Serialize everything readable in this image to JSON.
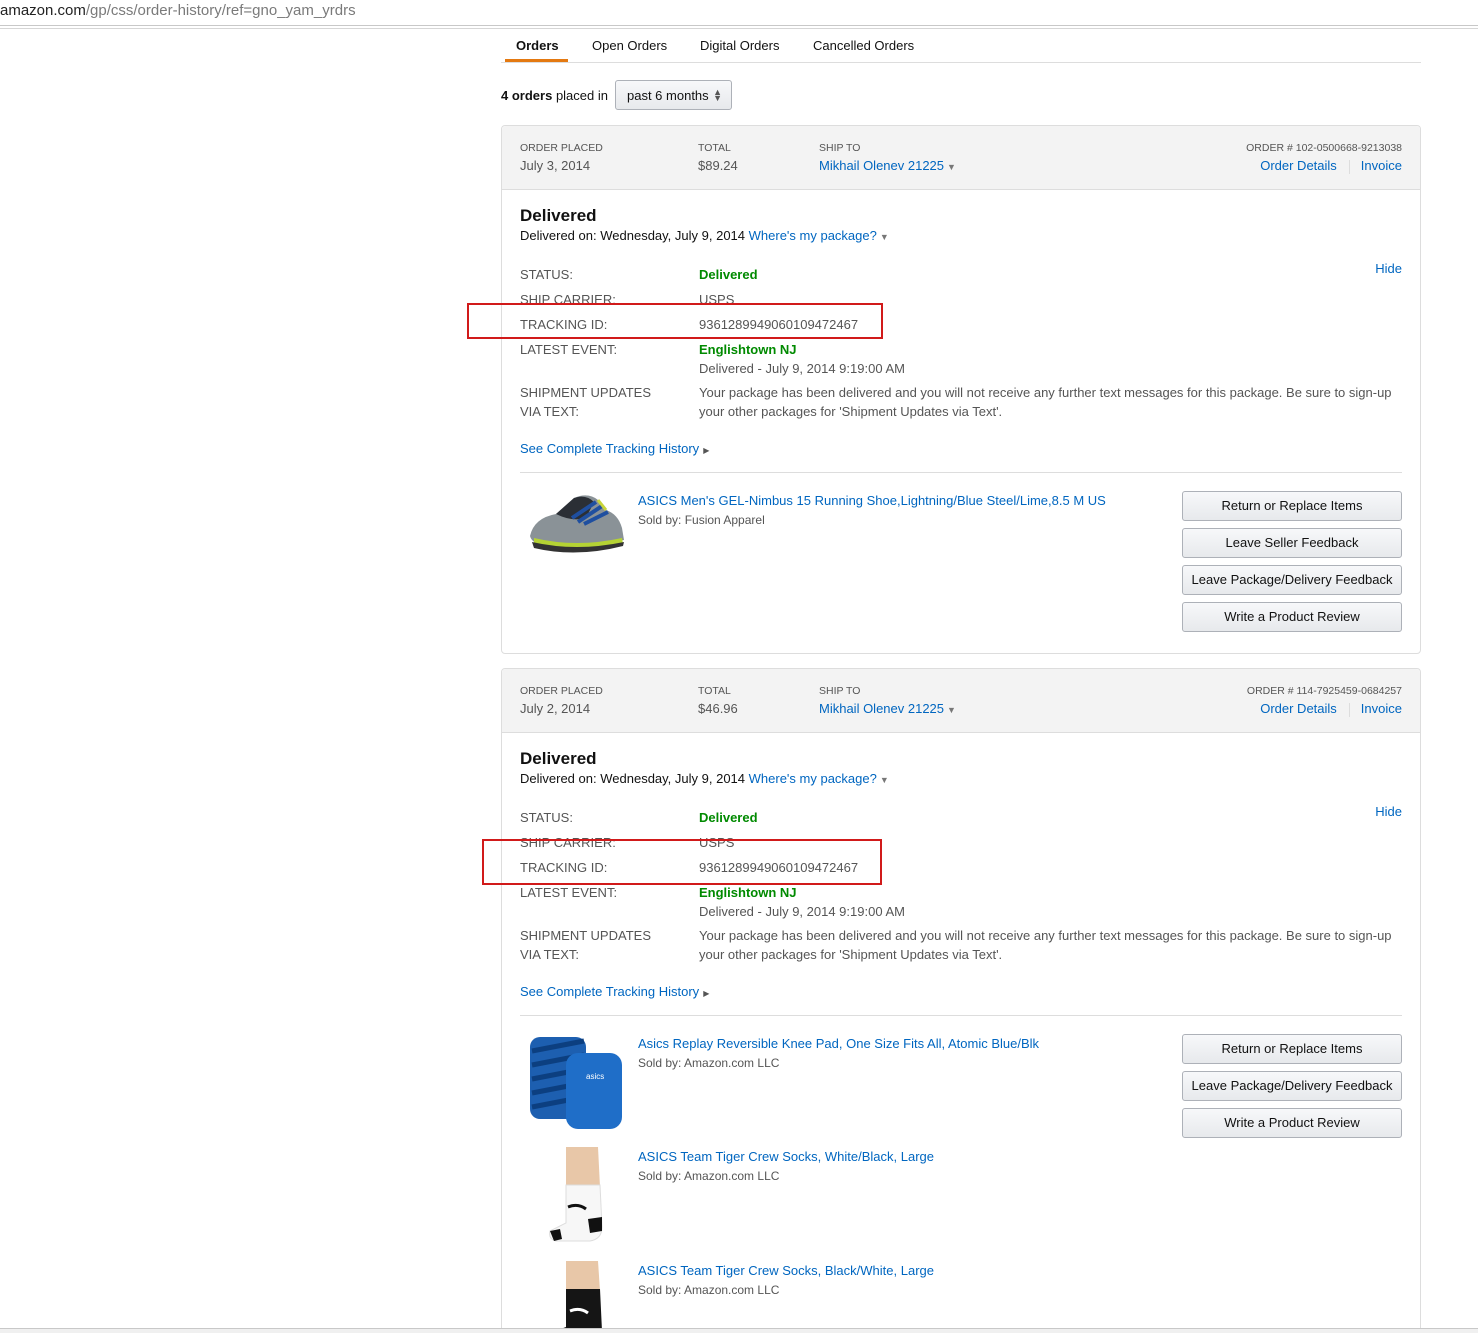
{
  "browser": {
    "url_host": "amazon.com",
    "url_path": "/gp/css/order-history/ref=gno_yam_yrdrs"
  },
  "tabs": [
    {
      "label": "Orders",
      "active": true
    },
    {
      "label": "Open Orders"
    },
    {
      "label": "Digital Orders"
    },
    {
      "label": "Cancelled Orders"
    }
  ],
  "summary": {
    "count_text": "4 orders",
    "placed_in": "placed in",
    "filter_value": "past 6 months"
  },
  "header_labels": {
    "order_placed": "ORDER PLACED",
    "total": "TOTAL",
    "ship_to": "SHIP TO",
    "order_details": "Order Details",
    "invoice": "Invoice"
  },
  "tracking_labels": {
    "status": "STATUS:",
    "carrier": "SHIP CARRIER:",
    "tracking_id": "TRACKING ID:",
    "latest_event": "LATEST EVENT:",
    "updates_line1": "SHIPMENT UPDATES",
    "updates_line2": "VIA TEXT:",
    "hide": "Hide",
    "history": "See Complete Tracking History",
    "delivered_on_prefix": "Delivered on:",
    "where_package": "Where's my package?"
  },
  "orders": [
    {
      "date": "July 3, 2014",
      "total": "$89.24",
      "ship_to": "Mikhail Olenev 21225",
      "order_number": "ORDER # 102-0500668-9213038",
      "status_title": "Delivered",
      "delivered_on": "Wednesday, July 9, 2014",
      "status": "Delivered",
      "carrier": "USPS",
      "tracking_id": "9361289949060109472467",
      "event_location": "Englishtown NJ",
      "event_detail": "Delivered - July 9, 2014 9:19:00 AM",
      "updates_text": "Your package has been delivered and you will not receive any further text messages for this package. Be sure to sign-up your other packages for 'Shipment Updates via Text'.",
      "items": [
        {
          "title": "ASICS Men's GEL-Nimbus 15 Running Shoe,Lightning/Blue Steel/Lime,8.5 M US",
          "seller": "Sold by: Fusion Apparel"
        }
      ],
      "buttons": [
        "Return or Replace Items",
        "Leave Seller Feedback",
        "Leave Package/Delivery Feedback",
        "Write a Product Review"
      ]
    },
    {
      "date": "July 2, 2014",
      "total": "$46.96",
      "ship_to": "Mikhail Olenev 21225",
      "order_number": "ORDER # 114-7925459-0684257",
      "status_title": "Delivered",
      "delivered_on": "Wednesday, July 9, 2014",
      "status": "Delivered",
      "carrier": "USPS",
      "tracking_id": "9361289949060109472467",
      "event_location": "Englishtown NJ",
      "event_detail": "Delivered - July 9, 2014 9:19:00 AM",
      "updates_text": "Your package has been delivered and you will not receive any further text messages for this package. Be sure to sign-up your other packages for 'Shipment Updates via Text'.",
      "items": [
        {
          "title": "Asics Replay Reversible Knee Pad, One Size Fits All, Atomic Blue/Blk",
          "seller": "Sold by: Amazon.com LLC"
        },
        {
          "title": "ASICS Team Tiger Crew Socks, White/Black, Large",
          "seller": "Sold by: Amazon.com LLC"
        },
        {
          "title": "ASICS Team Tiger Crew Socks, Black/White, Large",
          "seller": "Sold by: Amazon.com LLC"
        }
      ],
      "buttons": [
        "Return or Replace Items",
        "Leave Package/Delivery Feedback",
        "Write a Product Review"
      ]
    }
  ],
  "colors": {
    "link": "#0066c0",
    "status_green": "#008a00",
    "tab_accent": "#e47911",
    "highlight_box": "#d11a1a"
  }
}
